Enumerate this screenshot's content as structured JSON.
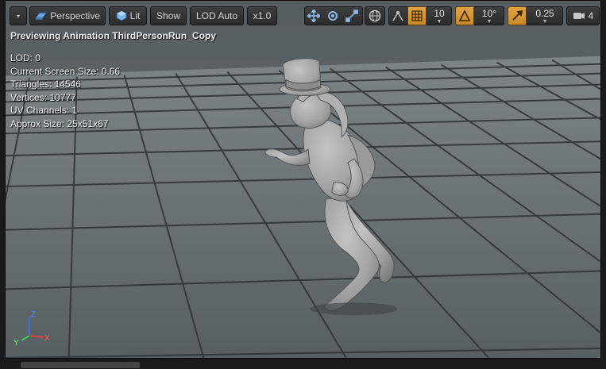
{
  "toolbar": {
    "menu_caret": "▾",
    "perspective_label": "Perspective",
    "lit_label": "Lit",
    "show_label": "Show",
    "lod_label": "LOD Auto",
    "speed_label": "x1.0",
    "grid_snap_value": "10",
    "angle_snap_value": "10°",
    "scale_snap_value": "0.25",
    "camera_speed_value": "4",
    "icons": [
      "viewport-menu-icon",
      "perspective-icon",
      "lit-icon",
      "translate-icon",
      "rotate-icon",
      "scale-icon",
      "world-local-icon",
      "surface-snap-icon",
      "grid-snap-icon",
      "angle-snap-icon",
      "scale-snap-icon",
      "camera-speed-icon"
    ],
    "accent_color": "#d59a35"
  },
  "overlay": {
    "preview_text": "Previewing Animation ThirdPersonRun_Copy",
    "stats": [
      "LOD: 0",
      "Current Screen Size: 0.66",
      "Triangles: 14546",
      "Vertices: 10777",
      "UV Channels: 1",
      "Approx Size: 25x51x67"
    ]
  },
  "gizmo": {
    "x_label": "X",
    "y_label": "Y",
    "z_label": "Z"
  },
  "colors": {
    "floor": "#6a7275",
    "floor_grid": "#2e3336",
    "character": "#a9a9a9",
    "sky": "#5a6163"
  }
}
